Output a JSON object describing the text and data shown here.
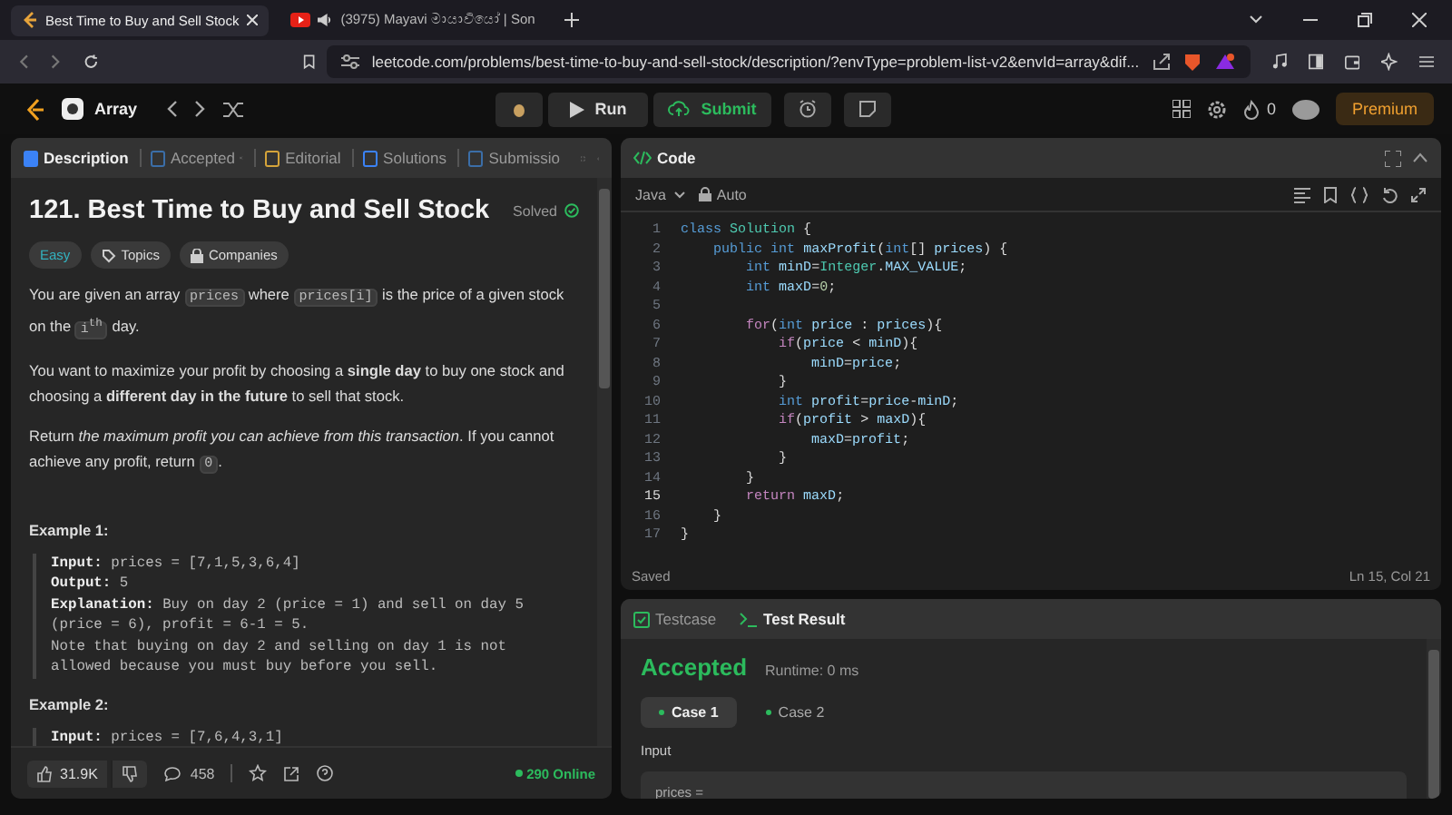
{
  "browser": {
    "tabs": [
      {
        "title": "Best Time to Buy and Sell Stock",
        "kind": "page",
        "selected": true
      },
      {
        "title": "(3975) Mayavi මායාවියෝ | Son",
        "kind": "media",
        "selected": false
      }
    ],
    "url": "leetcode.com/problems/best-time-to-buy-and-sell-stock/description/?envType=problem-list-v2&envId=array&dif..."
  },
  "toolbar": {
    "list_name": "Array",
    "run": "Run",
    "submit": "Submit",
    "streak": "0",
    "premium": "Premium"
  },
  "description_panel": {
    "tabs": [
      {
        "label": "Description",
        "kind": "description",
        "selected": true,
        "closable": false
      },
      {
        "label": "Accepted",
        "kind": "accepted",
        "selected": false,
        "closable": true
      },
      {
        "label": "Editorial",
        "kind": "editorial",
        "selected": false,
        "closable": false
      },
      {
        "label": "Solutions",
        "kind": "solutions",
        "selected": false,
        "closable": false
      },
      {
        "label": "Submissio",
        "kind": "submissions",
        "selected": false,
        "closable": false
      }
    ],
    "title": "121. Best Time to Buy and Sell Stock",
    "status": "Solved",
    "tags": [
      {
        "label": "Easy",
        "kind": "difficulty"
      },
      {
        "label": "Topics",
        "kind": "topics"
      },
      {
        "label": "Companies",
        "kind": "companies"
      }
    ],
    "paragraphs": [
      [
        {
          "kind": "text",
          "text": "You are given an array "
        },
        {
          "kind": "code",
          "text": "prices"
        },
        {
          "kind": "text",
          "text": " where "
        },
        {
          "kind": "code",
          "text": "prices[i]"
        },
        {
          "kind": "text",
          "text": " is the price of a given stock on the "
        },
        {
          "kind": "code",
          "text": "i$^{th}$"
        },
        {
          "kind": "text",
          "text": " day."
        }
      ],
      [
        {
          "kind": "text",
          "text": "You want to maximize your profit by choosing a **single day** to buy one stock and choosing a **different day in the future** to sell that stock."
        }
      ],
      [
        {
          "kind": "text",
          "text": "Return *the maximum profit you can achieve from this transaction*. If you cannot achieve any profit, return "
        },
        {
          "kind": "code",
          "text": "0"
        },
        {
          "kind": "text",
          "text": "."
        }
      ]
    ],
    "examples": [
      {
        "heading": "Example 1:",
        "lines": [
          {
            "label": "Input:",
            "text": "prices = [7,1,5,3,6,4]"
          },
          {
            "label": "Output:",
            "text": "5"
          },
          {
            "label": "Explanation:",
            "text": "Buy on day 2 (price = 1) and sell on day 5"
          },
          {
            "text": "(price = 6), profit = 6-1 = 5."
          },
          {
            "text": "Note that buying on day 2 and selling on day 1 is not"
          },
          {
            "text": "allowed because you must buy before you sell."
          }
        ]
      },
      {
        "heading": "Example 2:",
        "lines": [
          {
            "label": "Input:",
            "text": "prices = [7,6,4,3,1]"
          }
        ]
      }
    ],
    "footer": {
      "likes": "31.9K",
      "comments": "458",
      "online": "290 Online"
    }
  },
  "code_panel": {
    "title": "Code",
    "language": "Java",
    "mode": "Auto",
    "lines": [
      {
        "number": "1",
        "code": "class Solution {",
        "current": false
      },
      {
        "number": "2",
        "code": "    public int maxProfit(int[] prices) {",
        "current": false
      },
      {
        "number": "3",
        "code": "        int minD=Integer.MAX_VALUE;",
        "current": false
      },
      {
        "number": "4",
        "code": "        int maxD=0;",
        "current": false
      },
      {
        "number": "5",
        "current": false
      },
      {
        "number": "6",
        "code": "        for(int price : prices){",
        "current": false
      },
      {
        "number": "7",
        "code": "            if(price < minD){",
        "current": false
      },
      {
        "number": "8",
        "code": "                minD=price;",
        "current": false
      },
      {
        "number": "9",
        "code": "            }",
        "current": false
      },
      {
        "number": "10",
        "code": "            int profit=price-minD;",
        "current": false
      },
      {
        "number": "11",
        "code": "            if(profit > maxD){",
        "current": false
      },
      {
        "number": "12",
        "code": "                maxD=profit;",
        "current": false
      },
      {
        "number": "13",
        "code": "            }",
        "current": false
      },
      {
        "number": "14",
        "code": "        }",
        "current": false
      },
      {
        "number": "15",
        "code": "        return maxD;",
        "current": true
      },
      {
        "number": "16",
        "code": "    }",
        "current": false
      },
      {
        "number": "17",
        "code": "}",
        "current": false
      }
    ],
    "status": "Saved",
    "cursor": "Ln 15, Col 21"
  },
  "result_panel": {
    "tabs": [
      {
        "label": "Testcase",
        "selected": false
      },
      {
        "label": "Test Result",
        "selected": true
      }
    ],
    "verdict": "Accepted",
    "runtime": "Runtime: 0 ms",
    "cases": [
      {
        "label": "Case 1",
        "selected": true
      },
      {
        "label": "Case 2",
        "selected": false
      }
    ],
    "input_label": "Input",
    "input_value": "prices ="
  }
}
